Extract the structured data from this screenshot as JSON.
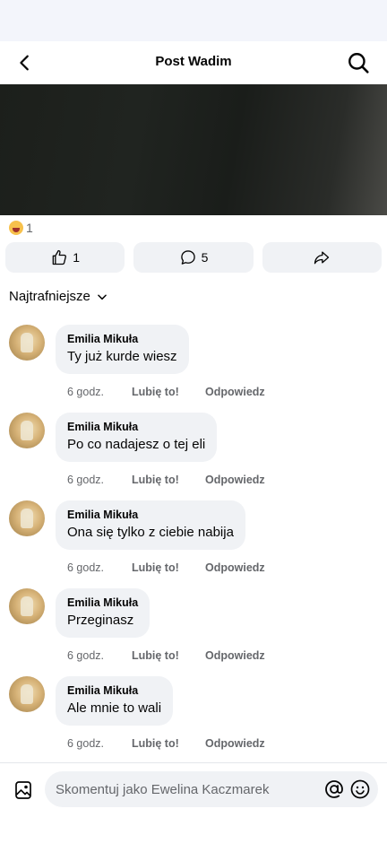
{
  "header": {
    "title": "Post Wadim"
  },
  "reactions": {
    "count": "1"
  },
  "actions": {
    "likes": "1",
    "comments": "5"
  },
  "sort": {
    "label": "Najtrafniejsze"
  },
  "comments": [
    {
      "author": "Emilia Mikuła",
      "text": "Ty już kurde wiesz",
      "time": "6 godz.",
      "like": "Lubię to!",
      "reply": "Odpowiedz"
    },
    {
      "author": "Emilia Mikuła",
      "text": "Po co nadajesz o tej eli",
      "time": "6 godz.",
      "like": "Lubię to!",
      "reply": "Odpowiedz"
    },
    {
      "author": "Emilia Mikuła",
      "text": "Ona się tylko z ciebie nabija",
      "time": "6 godz.",
      "like": "Lubię to!",
      "reply": "Odpowiedz"
    },
    {
      "author": "Emilia Mikuła",
      "text": "Przeginasz",
      "time": "6 godz.",
      "like": "Lubię to!",
      "reply": "Odpowiedz"
    },
    {
      "author": "Emilia Mikuła",
      "text": "Ale mnie to wali",
      "time": "6 godz.",
      "like": "Lubię to!",
      "reply": "Odpowiedz"
    }
  ],
  "composer": {
    "placeholder": "Skomentuj jako Ewelina Kaczmarek"
  },
  "icons": {
    "back": "chevron-left-icon",
    "search": "search-icon",
    "reaction": "haha-emoji-icon",
    "like": "thumbs-up-icon",
    "comment": "speech-bubble-icon",
    "share": "share-arrow-icon",
    "sort": "chevron-down-icon",
    "photo": "photo-icon",
    "mention": "at-icon",
    "emoji": "smiley-icon"
  },
  "colors": {
    "bubble": "#f0f2f5",
    "secondary_text": "#65676b",
    "primary_text": "#050505"
  }
}
